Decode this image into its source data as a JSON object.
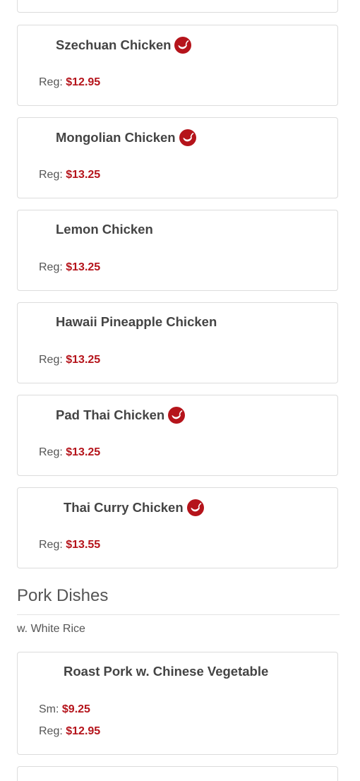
{
  "accent_color": "#b5141b",
  "chicken_items": [
    {
      "name": "Szechuan Chicken",
      "spicy": true,
      "prices": [
        {
          "label": "Reg:",
          "value": "$12.95"
        }
      ]
    },
    {
      "name": "Mongolian Chicken",
      "spicy": true,
      "prices": [
        {
          "label": "Reg:",
          "value": "$13.25"
        }
      ]
    },
    {
      "name": "Lemon Chicken",
      "spicy": false,
      "prices": [
        {
          "label": "Reg:",
          "value": "$13.25"
        }
      ]
    },
    {
      "name": "Hawaii Pineapple Chicken",
      "spicy": false,
      "prices": [
        {
          "label": "Reg:",
          "value": "$13.25"
        }
      ]
    },
    {
      "name": "Pad Thai Chicken",
      "spicy": true,
      "prices": [
        {
          "label": "Reg:",
          "value": "$13.25"
        }
      ]
    },
    {
      "name": "Thai Curry Chicken",
      "spicy": true,
      "prices": [
        {
          "label": "Reg:",
          "value": "$13.55"
        }
      ]
    }
  ],
  "pork_section": {
    "title": "Pork Dishes",
    "note": "w. White Rice",
    "items": [
      {
        "name": "Roast Pork w. Chinese Vegetable",
        "spicy": false,
        "prices": [
          {
            "label": "Sm:",
            "value": "$9.25"
          },
          {
            "label": "Reg:",
            "value": "$12.95"
          }
        ]
      }
    ]
  },
  "icons": {
    "spicy": "chili-pepper-icon"
  }
}
